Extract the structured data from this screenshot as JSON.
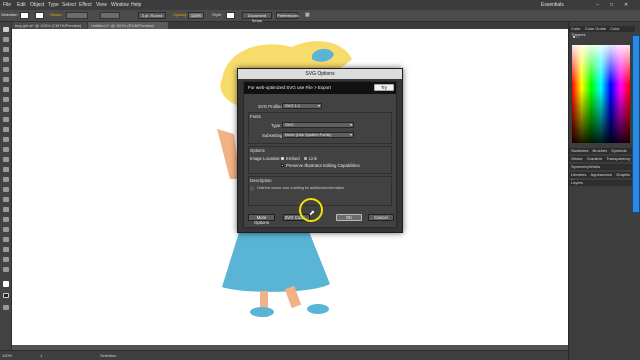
{
  "menu": {
    "items": [
      "File",
      "Edit",
      "Object",
      "Type",
      "Select",
      "Effect",
      "View",
      "Window",
      "Help"
    ],
    "workspace": "Essentials"
  },
  "control_bar": {
    "selection_label": "Selection",
    "stroke_label": "Stroke:",
    "brush_label": "3 pt. Round",
    "opacity_label": "Opacity:",
    "opacity_value": "100%",
    "style_label": "Style:",
    "document_setup": "Document Setup",
    "preferences": "Preferences"
  },
  "doc_tabs": [
    "bug girl.ai* @ 100% (CMYK/Preview)",
    "Untitled-1* @ 100% (RGB/Preview)"
  ],
  "status": {
    "zoom": "100%",
    "page": "1",
    "tool": "Selection"
  },
  "right_panel": {
    "color_tabs": [
      "Color",
      "Color Guide",
      "Color Themes"
    ],
    "swatch_tabs": [
      "Swatches",
      "Brushes",
      "Symbols"
    ],
    "stroke_tabs": [
      "Stroke",
      "Gradient",
      "Transparency"
    ],
    "symmetry": "SymmetryWorks",
    "library_tabs": [
      "Libraries",
      "Appearance",
      "Graphic Styles"
    ],
    "layers": "Layers"
  },
  "dialog": {
    "title": "SVG Options",
    "header_text": "For web-optimized SVG use File > Export",
    "try_label": "Try",
    "svg_profiles_label": "SVG Profiles:",
    "svg_profiles_value": "SVG 1.1",
    "fonts_section": "Fonts",
    "type_label": "Type:",
    "type_value": "SVG",
    "subsetting_label": "Subsetting:",
    "subsetting_value": "None (Use System Fonts)",
    "options_section": "Options",
    "image_location_label": "Image Location:",
    "embed_label": "Embed",
    "link_label": "Link",
    "preserve_label": "Preserve Illustrator Editing Capabilities",
    "description_section": "Description",
    "description_text": "Hold the cursor over a setting for additional information.",
    "more_options": "More Options",
    "svg_code": "SVG Code...",
    "ok": "OK",
    "cancel": "Cancel"
  },
  "colors": {
    "hair": "#f8dc6b",
    "dress": "#5ab4d6",
    "skin": "#f0b286",
    "bow": "#5ab4d6",
    "cursor_ring": "#f2e400"
  }
}
